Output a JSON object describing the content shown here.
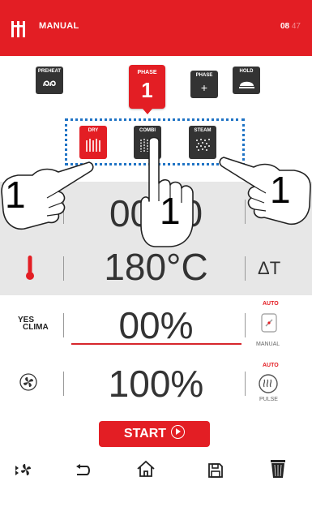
{
  "header": {
    "title": "MANUAL",
    "time_hours": "08",
    "time_minutes": "47"
  },
  "top_buttons": {
    "preheat": "PREHEAT",
    "phase": {
      "label": "PHASE",
      "number": "1"
    },
    "phase_add": {
      "label": "PHASE",
      "icon": "+"
    },
    "hold": "HOLD"
  },
  "modes": {
    "dry": "DRY",
    "combi": "COMBI",
    "steam": "STEAM"
  },
  "rows": {
    "time_value": "00:00",
    "temperature_value": "180°C",
    "delta_t": "ΔT",
    "humidity_value": "00%",
    "humidity_label_top": "YES",
    "humidity_label_bottom": "CLIMA",
    "humidity_auto": "AUTO",
    "humidity_manual": "MANUAL",
    "fan_value": "100%",
    "fan_auto": "AUTO",
    "fan_pulse": "PULSE"
  },
  "start_label": "START",
  "annotations": {
    "left": "1",
    "middle": "1",
    "right": "1"
  },
  "colors": {
    "accent": "#e31e24",
    "dark_button": "#333333",
    "highlight": "#1f73c5"
  }
}
